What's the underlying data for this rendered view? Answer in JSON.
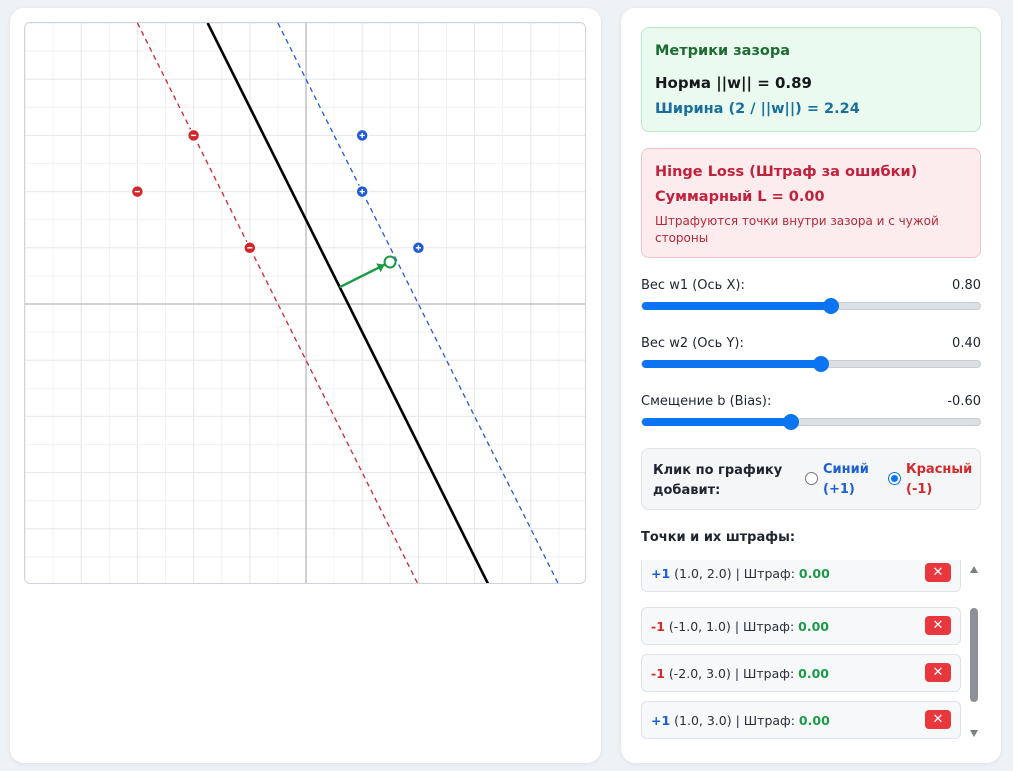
{
  "metrics": {
    "title": "Метрики зазора",
    "norm": "Норма ||w|| = 0.89",
    "width": "Ширина (2 / ||w||) = 2.24"
  },
  "hinge": {
    "title": "Hinge Loss (Штраф за ошибки)",
    "total": "Суммарный L = 0.00",
    "note": "Штрафуются точки внутри зазора и с чужой стороны"
  },
  "sliders": [
    {
      "label": "Вес w1 (Ось X):",
      "value": "0.80",
      "fraction": 0.56
    },
    {
      "label": "Вес w2 (Ось Y):",
      "value": "0.40",
      "fraction": 0.53
    },
    {
      "label": "Смещение b (Bias):",
      "value": "-0.60",
      "fraction": 0.44
    }
  ],
  "click_mode": {
    "label": "Клик по графику добавит:",
    "options": [
      {
        "label": "Синий (+1)",
        "color": "#1a5fd6",
        "selected": false
      },
      {
        "label": "Красный (-1)",
        "color": "#d22a2a",
        "selected": true
      }
    ]
  },
  "points_title": "Точки и их штрафы:",
  "points_list": [
    {
      "label": "+1",
      "coords": "(1.0, 2.0)",
      "penalty_prefix": "| Штраф:",
      "penalty": "0.00"
    },
    {
      "label": "-1",
      "coords": "(-1.0, 1.0)",
      "penalty_prefix": "| Штраф:",
      "penalty": "0.00"
    },
    {
      "label": "-1",
      "coords": "(-2.0, 3.0)",
      "penalty_prefix": "| Штраф:",
      "penalty": "0.00"
    },
    {
      "label": "+1",
      "coords": "(1.0, 3.0)",
      "penalty_prefix": "| Штраф:",
      "penalty": "0.00"
    }
  ],
  "delete_icon": "close-icon",
  "plot": {
    "x_range": [
      -5,
      5
    ],
    "y_range": [
      -5,
      5
    ],
    "w": [
      0.8,
      0.4
    ],
    "b": -0.6,
    "points": [
      {
        "x": -3,
        "y": 2,
        "label": -1
      },
      {
        "x": -2,
        "y": 3,
        "label": -1
      },
      {
        "x": -1,
        "y": 1,
        "label": -1
      },
      {
        "x": 1,
        "y": 3,
        "label": 1
      },
      {
        "x": 1,
        "y": 2,
        "label": 1
      },
      {
        "x": 2,
        "y": 1,
        "label": 1
      }
    ],
    "colors": {
      "positive": "#1f5ad8",
      "negative": "#d2262b",
      "boundary": "#000000",
      "normal_arrow": "#1c9a48",
      "grid": "#e6e8ec",
      "axis": "#b5b8bd"
    }
  }
}
